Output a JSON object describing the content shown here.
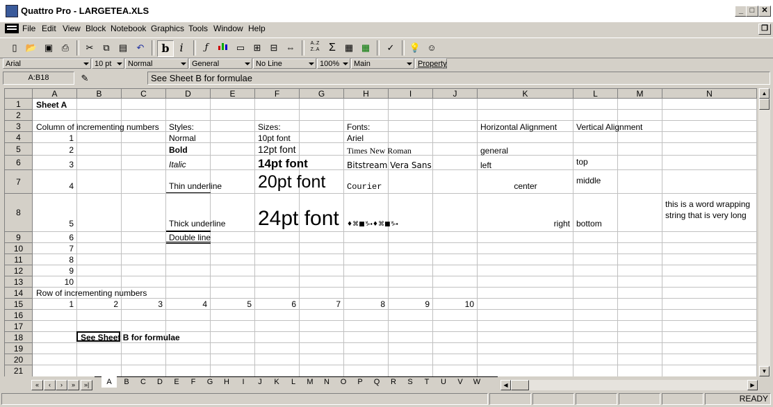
{
  "window": {
    "title": "Quattro Pro - LARGETEA.XLS"
  },
  "menu": [
    "File",
    "Edit",
    "View",
    "Block",
    "Notebook",
    "Graphics",
    "Tools",
    "Window",
    "Help"
  ],
  "toolbar": {
    "icons": [
      "new-icon",
      "open-icon",
      "save-icon",
      "print-icon",
      "cut-icon",
      "copy-icon",
      "paste-icon",
      "undo-icon",
      "bold-icon",
      "italic-icon",
      "function-icon",
      "chart-icon",
      "rectangle-icon",
      "insert-icon",
      "delete-icon",
      "fit-icon",
      "sort-icon",
      "sum-icon",
      "format-icon",
      "table-icon",
      "checkmark-icon",
      "lightbulb-icon",
      "expert-icon"
    ],
    "bold_label": "b",
    "italic_label": "i",
    "sigma": "Σ"
  },
  "property_bar": {
    "font": "Arial",
    "size": "10 pt",
    "style": "Normal",
    "format": "General",
    "border": "No Line",
    "zoom": "100%",
    "mode": "Main",
    "property_button": "Property"
  },
  "input_line": {
    "cell_ref": "A:B18",
    "content": "See Sheet B for formulae"
  },
  "grid": {
    "columns": [
      "A",
      "B",
      "C",
      "D",
      "E",
      "F",
      "G",
      "H",
      "I",
      "J",
      "K",
      "L",
      "M",
      "N"
    ],
    "rows": [
      "1",
      "2",
      "3",
      "4",
      "5",
      "6",
      "7",
      "8",
      "9",
      "10",
      "11",
      "12",
      "13",
      "14",
      "15",
      "16",
      "17",
      "18",
      "19",
      "20",
      "21"
    ],
    "cells": {
      "a1": "Sheet A",
      "a3": "Column of incrementing numbers",
      "a4": "1",
      "a5": "2",
      "a6": "3",
      "a7": "4",
      "a8": "5",
      "a9": "6",
      "a10": "7",
      "a11": "8",
      "a12": "9",
      "a13": "10",
      "a14": "Row of incrementing numbers",
      "r15": [
        "1",
        "2",
        "3",
        "4",
        "5",
        "6",
        "7",
        "8",
        "9",
        "10"
      ],
      "b18": "See Sheet B for formulae",
      "d3": "Styles:",
      "d4": "Normal",
      "d5": "Bold",
      "d6": "Italic",
      "d7": "Thin underline",
      "d8": "Thick underline",
      "d9": "Double line",
      "f3": "Sizes:",
      "f4": "10pt font",
      "f5": "12pt font",
      "f6": "14pt font",
      "f7": "20pt font",
      "f8": "24pt font",
      "h3": "Fonts:",
      "h4": "Ariel",
      "h5": "Times New Roman",
      "h6": "Bitstream Vera Sans",
      "h7": "Courier",
      "h8": "♦⌘■♑⬩♦⌘■♑⬩",
      "k3": "Horizontal Alignment",
      "k5": "general",
      "k6": "left",
      "k7": "center",
      "k8": "right",
      "l3": "Vertical Alignment",
      "l6": "top",
      "l7": "middle",
      "l8": "bottom",
      "n8": "this is a word wrapping string that is very long"
    }
  },
  "sheet_tabs": [
    "A",
    "B",
    "C",
    "D",
    "E",
    "F",
    "G",
    "H",
    "I",
    "J",
    "K",
    "L",
    "M",
    "N",
    "O",
    "P",
    "Q",
    "R",
    "S",
    "T",
    "U",
    "V",
    "W"
  ],
  "status": {
    "mode": "READY"
  }
}
